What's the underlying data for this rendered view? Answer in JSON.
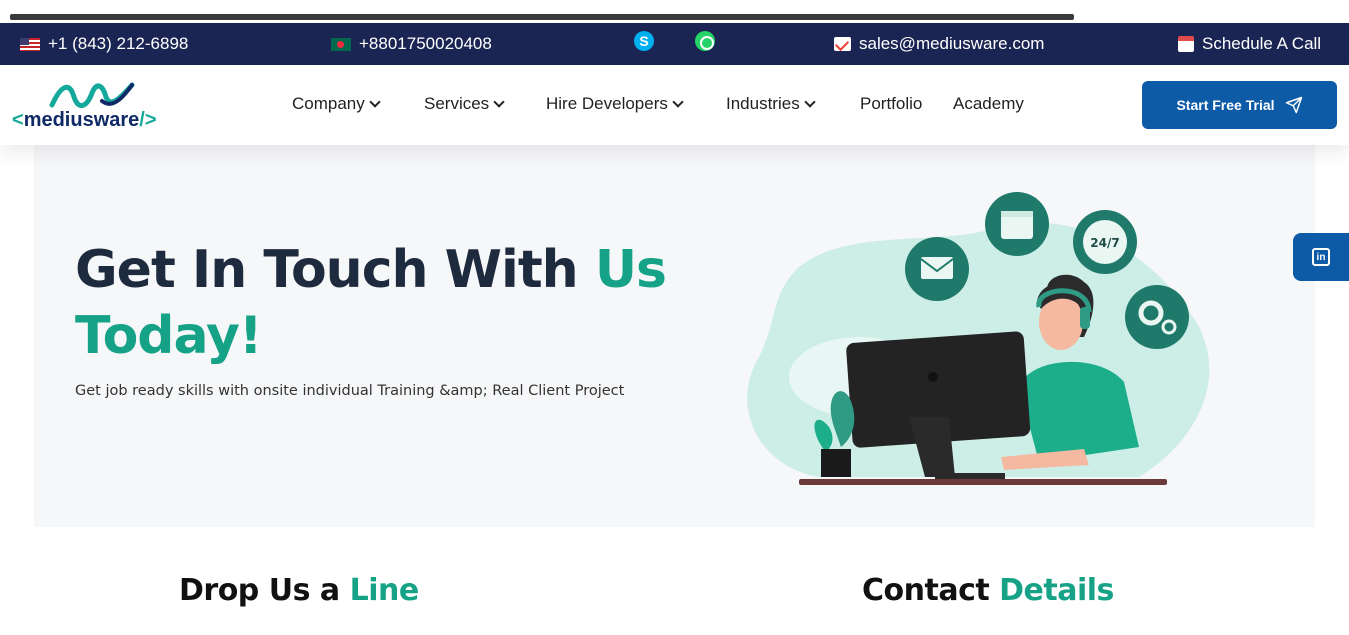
{
  "topbar": {
    "phone_us": "+1 (843) 212-6898",
    "phone_bd": "+8801750020408",
    "email": "sales@mediusware.com",
    "schedule": "Schedule A Call"
  },
  "logo": {
    "text": "mediusware",
    "open_bracket": "<",
    "close_bracket": "/>"
  },
  "nav": {
    "company": "Company",
    "services": "Services",
    "hire_developers": "Hire Developers",
    "industries": "Industries",
    "portfolio": "Portfolio",
    "academy": "Academy"
  },
  "cta": {
    "label": "Start Free Trial"
  },
  "hero": {
    "title_part1": "Get In Touch With ",
    "title_accent1": "Us",
    "title_accent2": "Today!",
    "subtitle": "Get job ready skills with onsite individual Training &amp; Real Client Project"
  },
  "illustration": {
    "badge_247": "24/7"
  },
  "sections": {
    "drop_part1": "Drop Us a ",
    "drop_accent": "Line",
    "contact_part1": "Contact ",
    "contact_accent": "Details"
  },
  "social": {
    "linkedin": "in"
  },
  "colors": {
    "navy": "#1b2553",
    "accent": "#16a287",
    "primary_button": "#0d5aa6"
  },
  "icons": [
    "flag-us-icon",
    "flag-bd-icon",
    "skype-icon",
    "whatsapp-icon",
    "gmail-icon",
    "calendar-icon",
    "chevron-down-icon",
    "send-icon",
    "linkedin-icon"
  ]
}
